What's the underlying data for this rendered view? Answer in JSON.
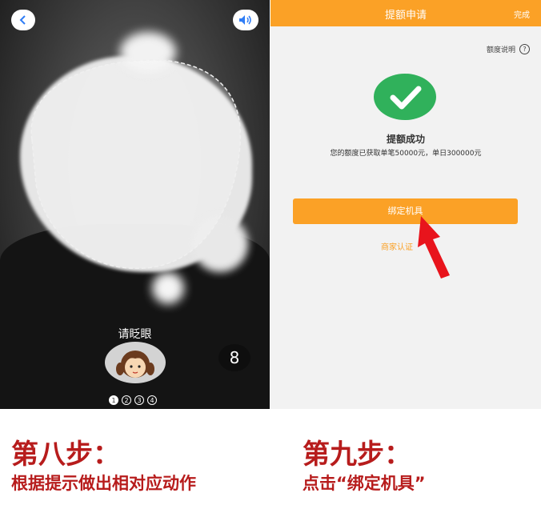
{
  "left_screen": {
    "prompt_text": "请眨眼",
    "countdown": "8",
    "steps": [
      "1",
      "2",
      "3",
      "4"
    ],
    "active_step": 1
  },
  "right_screen": {
    "title": "提额申请",
    "done_label": "完成",
    "limit_info_label": "额度说明",
    "help_icon": "?",
    "success_title": "提额成功",
    "success_desc": "您的额度已获取单笔50000元，单日300000元",
    "bind_button_label": "绑定机具",
    "merchant_link_label": "商家认证"
  },
  "captions": {
    "left_title": "第八步：",
    "left_sub": "根据提示做出相对应动作",
    "right_title": "第九步：",
    "right_sub": "点击“绑定机具”"
  },
  "colors": {
    "accent_orange": "#fba126",
    "success_green": "#30b15b",
    "caption_red": "#b71c1c",
    "arrow_red": "#e8141c"
  }
}
